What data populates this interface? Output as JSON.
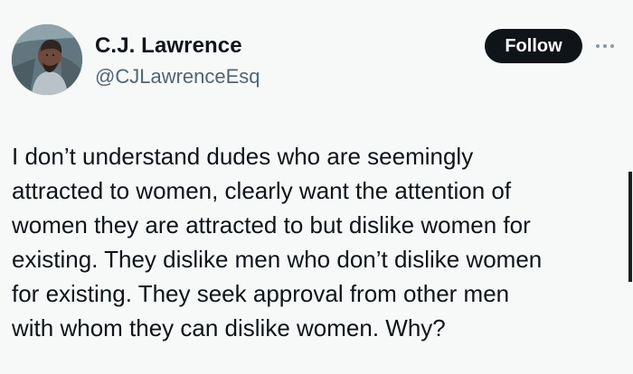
{
  "author": {
    "display_name": "C.J. Lawrence",
    "handle": "@CJLawrenceEsq"
  },
  "actions": {
    "follow_label": "Follow"
  },
  "tweet": {
    "text": "I don’t understand dudes who are seemingly\nattracted to women, clearly want the attention of\nwomen they are attracted to but dislike women for\nexisting. They dislike men who don’t dislike women\nfor existing. They seek approval from other men\nwith whom they can dislike women. Why?"
  },
  "icons": {
    "avatar": "profile-photo",
    "more": "more-dots-icon"
  },
  "colors": {
    "background": "#f7f9f9",
    "text": "#0f1419",
    "secondary_text": "#536471",
    "button": "#0f1419",
    "button_text": "#ffffff"
  }
}
